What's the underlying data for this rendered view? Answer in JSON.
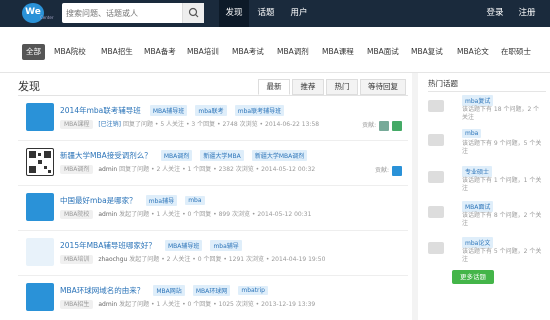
{
  "logo": {
    "text": "We",
    "sub": "Center"
  },
  "search": {
    "placeholder": "搜索问题、话题或人"
  },
  "nav": {
    "items": [
      {
        "label": "发现"
      },
      {
        "label": "话题"
      },
      {
        "label": "用户"
      }
    ],
    "login": "登录",
    "register": "注册"
  },
  "categories": [
    "全部",
    "MBA院校",
    "MBA招生",
    "MBA备考",
    "MBA培训",
    "MBA考试",
    "MBA调剂",
    "MBA课程",
    "MBA面试",
    "MBA复试",
    "MBA论文",
    "在职硕士"
  ],
  "main": {
    "title": "发现",
    "tabs": [
      "最新",
      "推荐",
      "热门",
      "等待回复"
    ],
    "items": [
      {
        "title": "2014年mba联考辅导班",
        "tags": [
          "MBA辅导班",
          "mba联考",
          "mba联考辅导班"
        ],
        "category": "MBA课程",
        "status": "[已注销]",
        "action": "回复了问题",
        "stats": "• 5 人关注 • 3 个回复 • 2748 次浏览 • 2014-06-22 13:58",
        "contrib": "贡献:"
      },
      {
        "title": "新疆大学MBA接受调剂么？",
        "tags": [
          "MBA调剂",
          "新疆大学MBA",
          "新疆大学MBA调剂"
        ],
        "category": "MBA调剂",
        "user": "admin",
        "action": "回复了问题",
        "stats": "• 2 人关注 • 1 个回复 • 2382 次浏览 • 2014-05-12 00:32",
        "contrib": "贡献:"
      },
      {
        "title": "中国最好mba是哪家？",
        "tags": [
          "mba辅导",
          "mba"
        ],
        "category": "MBA院校",
        "user": "admin",
        "action": "发起了问题",
        "stats": "• 1 人关注 • 0 个回复 • 899 次浏览 • 2014-05-12 00:31"
      },
      {
        "title": "2015年MBA辅导班哪家好？",
        "tags": [
          "MBA辅导班",
          "mba辅导"
        ],
        "category": "MBA培训",
        "user": "zhaochgu",
        "action": "发起了问题",
        "stats": "• 2 人关注 • 0 个回复 • 1291 次浏览 • 2014-04-19 19:50"
      },
      {
        "title": "MBA环球网域名的由来？",
        "tags": [
          "MBA网站",
          "MBA环球网",
          "mbatrip"
        ],
        "category": "MBA招生",
        "user": "admin",
        "action": "发起了问题",
        "stats": "• 1 人关注 • 0 个回复 • 1025 次浏览 • 2013-12-19 13:39"
      }
    ]
  },
  "sidebar": {
    "title": "热门话题",
    "topics": [
      {
        "tag": "mba复试",
        "stat": "该话题下有 18 个问题，2 个关注"
      },
      {
        "tag": "mba",
        "stat": "该话题下有 9 个问题，5 个关注"
      },
      {
        "tag": "专业硕士",
        "stat": "该话题下有 1 个问题，1 个关注"
      },
      {
        "tag": "MBA面试",
        "stat": "该话题下有 8 个问题，2 个关注"
      },
      {
        "tag": "mba论文",
        "stat": "该话题下有 5 个问题，2 个关注"
      }
    ],
    "more": "更多话题"
  },
  "colors": {
    "topbar": "#1a2a3c",
    "accent": "#2a73b8",
    "tagbg": "#dfeefa",
    "green": "#44b549"
  }
}
